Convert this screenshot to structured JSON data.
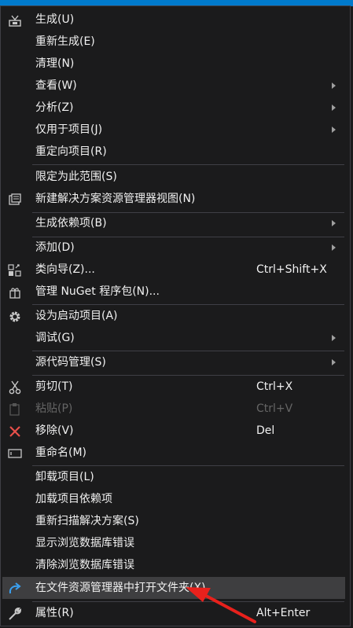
{
  "menu": {
    "build": "生成(U)",
    "rebuild": "重新生成(E)",
    "clean": "清理(N)",
    "view": "查看(W)",
    "analyze": "分析(Z)",
    "project_only": "仅用于项目(J)",
    "retarget": "重定向项目(R)",
    "scope_to_this": "限定为此范围(S)",
    "new_solution_explorer_view": "新建解决方案资源管理器视图(N)",
    "build_dependencies": "生成依赖项(B)",
    "add": "添加(D)",
    "class_wizard": "类向导(Z)...",
    "class_wizard_shortcut": "Ctrl+Shift+X",
    "manage_nuget": "管理 NuGet 程序包(N)...",
    "set_startup": "设为启动项目(A)",
    "debug": "调试(G)",
    "source_control": "源代码管理(S)",
    "cut": "剪切(T)",
    "cut_shortcut": "Ctrl+X",
    "paste": "粘贴(P)",
    "paste_shortcut": "Ctrl+V",
    "remove": "移除(V)",
    "remove_shortcut": "Del",
    "rename": "重命名(M)",
    "unload_project": "卸载项目(L)",
    "load_dependencies": "加载项目依赖项",
    "rescan_solution": "重新扫描解决方案(S)",
    "show_db_errors": "显示浏览数据库错误",
    "clear_db_errors": "清除浏览数据库错误",
    "open_in_explorer": "在文件资源管理器中打开文件夹(X)",
    "properties": "属性(R)",
    "properties_shortcut": "Alt+Enter"
  },
  "colors": {
    "background": "#1b1b1c",
    "highlight": "#3e3e40",
    "text": "#f1f1f1",
    "disabled_text": "#656565",
    "annotation_arrow": "#e8211c",
    "accent": "#007acc"
  }
}
